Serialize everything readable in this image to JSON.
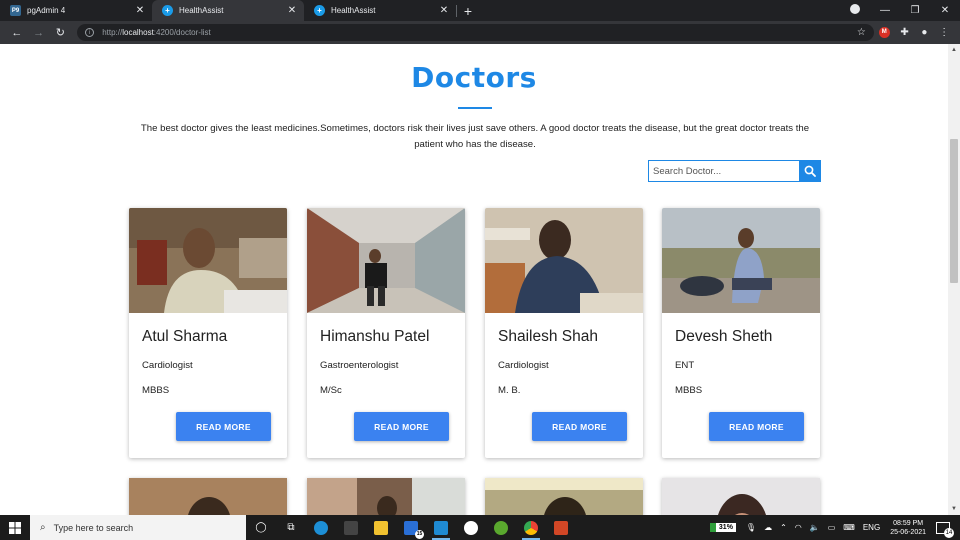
{
  "browser": {
    "tabs": [
      {
        "title": "pgAdmin 4",
        "favicon_text": "P9",
        "active": false
      },
      {
        "title": "HealthAssist",
        "favicon_text": "+",
        "active": true
      },
      {
        "title": "HealthAssist",
        "favicon_text": "+",
        "active": false
      }
    ],
    "url_prefix": "http://",
    "url_host": "localhost",
    "url_path": ":4200/doctor-list",
    "extension_badge": "M"
  },
  "page": {
    "heading": "Doctors",
    "tagline": "The best doctor gives the least medicines.Sometimes, doctors risk their lives just save others. A good doctor treats the disease, but the great doctor treats the patient who has the disease.",
    "search_placeholder": "Search Doctor...",
    "read_more_label": "READ MORE",
    "doctors": [
      {
        "name": "Atul Sharma",
        "specialty": "Cardiologist",
        "degree": "MBBS"
      },
      {
        "name": "Himanshu Patel",
        "specialty": "Gastroenterologist",
        "degree": "M/Sc"
      },
      {
        "name": "Shailesh Shah",
        "specialty": "Cardiologist",
        "degree": "M. B."
      },
      {
        "name": "Devesh Sheth",
        "specialty": "ENT",
        "degree": "MBBS"
      }
    ]
  },
  "taskbar": {
    "search_placeholder": "Type here to search",
    "mail_badge": "15",
    "battery": "31%",
    "language": "ENG",
    "time": "08:59 PM",
    "date": "25-06-2021",
    "notification_count": "14"
  },
  "colors": {
    "accent": "#1e88e5",
    "button": "#3b82f0"
  }
}
